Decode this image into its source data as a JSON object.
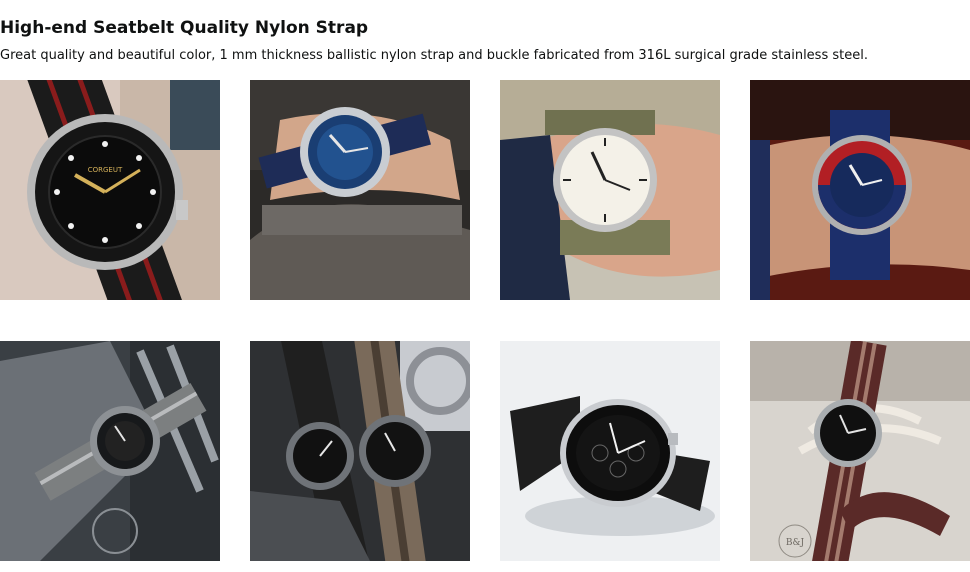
{
  "heading": {
    "title": "High-end Seatbelt Quality Nylon Strap",
    "description": "Great quality and beautiful color, 1 mm thickness ballistic nylon strap and buckle fabricated from 316L surgical grade stainless steel."
  },
  "gallery": {
    "images": [
      {
        "alt": "Black dive watch on black and red striped nylon strap",
        "brand_text": "CORGEUT"
      },
      {
        "alt": "Blue dial watch on navy nylon strap on wrist"
      },
      {
        "alt": "Field watch with white dial on olive nylon strap on wrist"
      },
      {
        "alt": "Pepsi bezel dive watch on blue nylon strap on wrist"
      },
      {
        "alt": "Dive watch on grey nylon strap with tools"
      },
      {
        "alt": "Two watches on black and brown nylon straps with carabiner"
      },
      {
        "alt": "Chronograph watch on black nylon strap"
      },
      {
        "alt": "Dive watch on brown and red striped nylon strap with rope",
        "brand_text": "B&J"
      }
    ]
  }
}
